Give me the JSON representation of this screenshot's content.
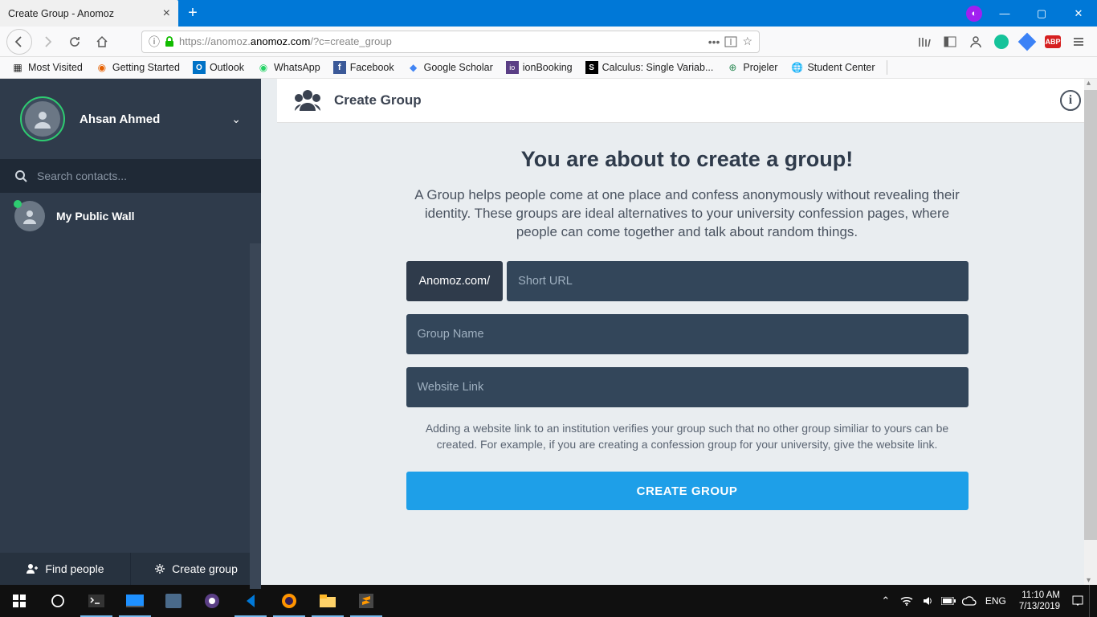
{
  "browser": {
    "tab_title": "Create Group - Anomoz",
    "url_proto": "https://",
    "url_sub": "anomoz.",
    "url_domain": "anomoz.com",
    "url_path": "/?c=create_group"
  },
  "bookmarks": [
    {
      "label": "Most Visited"
    },
    {
      "label": "Getting Started"
    },
    {
      "label": "Outlook"
    },
    {
      "label": "WhatsApp"
    },
    {
      "label": "Facebook"
    },
    {
      "label": "Google Scholar"
    },
    {
      "label": "ionBooking"
    },
    {
      "label": "Calculus: Single Variab..."
    },
    {
      "label": "Projeler"
    },
    {
      "label": "Student Center"
    }
  ],
  "sidebar": {
    "user_name": "Ahsan Ahmed",
    "search_placeholder": "Search contacts...",
    "contact_name": "My Public Wall",
    "find_people": "Find people",
    "create_group": "Create group"
  },
  "main": {
    "header": "Create Group",
    "title": "You are about to create a group!",
    "desc": "A Group helps people come at one place and confess anonymously without revealing their identity. These groups are ideal alternatives to your university confession pages, where people can come together and talk about random things.",
    "url_prefix": "Anomoz.com/",
    "short_url_ph": "Short URL",
    "group_name_ph": "Group Name",
    "website_ph": "Website Link",
    "hint": "Adding a website link to an institution verifies your group such that no other group similiar to yours can be created. For example, if you are creating a confession group for your university, give the website link.",
    "submit": "CREATE GROUP"
  },
  "taskbar": {
    "lang": "ENG",
    "time": "11:10 AM",
    "date": "7/13/2019"
  }
}
